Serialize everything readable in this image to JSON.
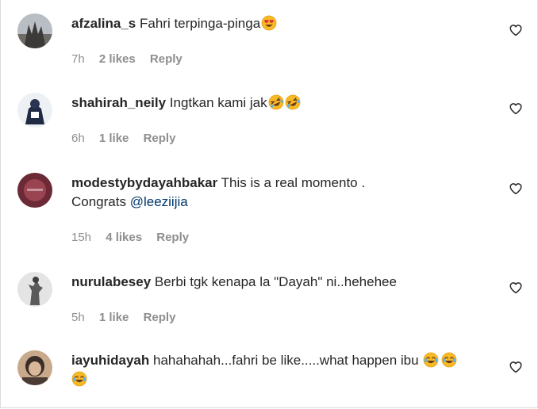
{
  "comments": [
    {
      "username": "afzalina_s",
      "text": "Fahri terpinga-pinga",
      "emojis": [
        "heart-eyes"
      ],
      "time": "7h",
      "likes": "2 likes",
      "reply": "Reply",
      "avatar_colors": [
        "#8a8f96",
        "#3c3a38"
      ]
    },
    {
      "username": "shahirah_neily",
      "text": "Ingtkan kami jak",
      "emojis": [
        "rolling-laugh",
        "rolling-laugh"
      ],
      "time": "6h",
      "likes": "1 like",
      "reply": "Reply",
      "avatar_colors": [
        "#eef1f4",
        "#1f2a44"
      ]
    },
    {
      "username": "modestybydayahbakar",
      "text": "This is a real momento .",
      "text_line2": "Congrats ",
      "mention": "@leeziijia",
      "emojis": [],
      "time": "15h",
      "likes": "4 likes",
      "reply": "Reply",
      "avatar_colors": [
        "#6b2a35",
        "#9a4452"
      ]
    },
    {
      "username": "nurulabesey",
      "text": "Berbi tgk kenapa la \"Dayah\" ni..hehehee",
      "emojis": [],
      "time": "5h",
      "likes": "1 like",
      "reply": "Reply",
      "avatar_colors": [
        "#e4e4e4",
        "#5a5a5a"
      ]
    },
    {
      "username": "iayuhidayah",
      "text": "hahahahah...fahri be like.....what happen ibu",
      "emojis": [
        "tears-of-joy",
        "tears-of-joy",
        "tears-of-joy"
      ],
      "avatar_colors": [
        "#c9a98b",
        "#3a2e28"
      ]
    }
  ],
  "icons": {
    "like": "heart-outline-icon"
  },
  "colors": {
    "text": "#262626",
    "meta": "#8e8e8e",
    "mention": "#00376b",
    "emoji_face": "#f7b924"
  }
}
